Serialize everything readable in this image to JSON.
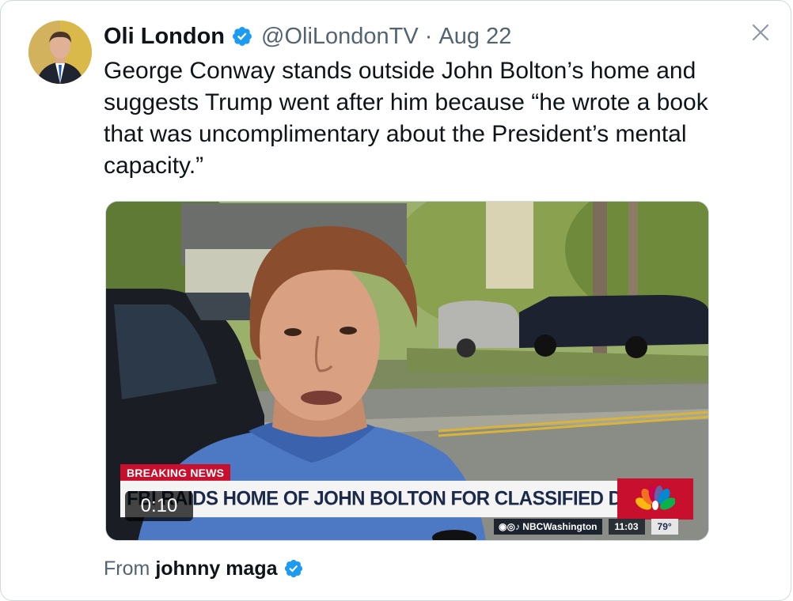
{
  "tweet": {
    "author_name": "Oli London",
    "handle": "@OliLondonTV",
    "separator": "·",
    "date": "Aug 22",
    "text": "George Conway stands outside John Bolton’s home and suggests Trump went after him because “he wrote a book that was uncomplimentary about the President’s mental capacity.”",
    "close_icon": "close-icon",
    "verified_icon": "verified-badge-icon"
  },
  "media": {
    "breaking_label": "BREAKING NEWS",
    "headline": "FBI RAIDS HOME OF JOHN BOLTON FOR CLASSIFIED DOCUMENTS",
    "station": "NBCWashington",
    "clock": "11:03",
    "temperature": "79°",
    "video_timer": "0:10",
    "network_logo": "nbc-peacock-logo"
  },
  "footer": {
    "from_label": "From",
    "source_name": "johnny maga"
  },
  "colors": {
    "verified_blue": "#1d9bf0",
    "text_primary": "#0f1419",
    "text_secondary": "#536471",
    "breaking_red": "#c8102e"
  }
}
